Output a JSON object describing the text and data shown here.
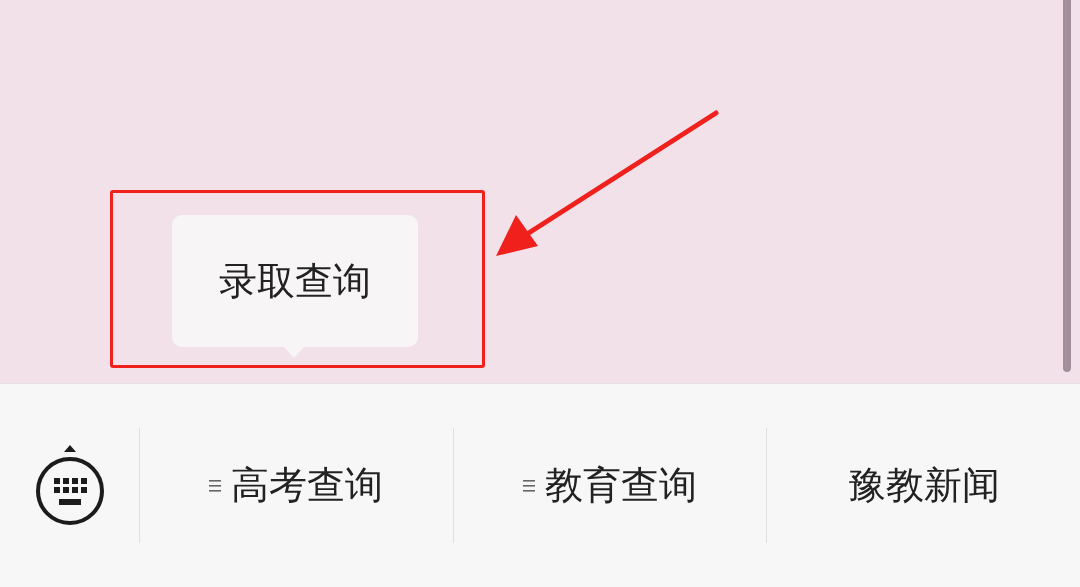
{
  "submenu": {
    "items": [
      "录取查询"
    ]
  },
  "menu": [
    {
      "label": "高考查询",
      "has_submenu": true
    },
    {
      "label": "教育查询",
      "has_submenu": true
    },
    {
      "label": "豫教新闻",
      "has_submenu": false
    }
  ]
}
